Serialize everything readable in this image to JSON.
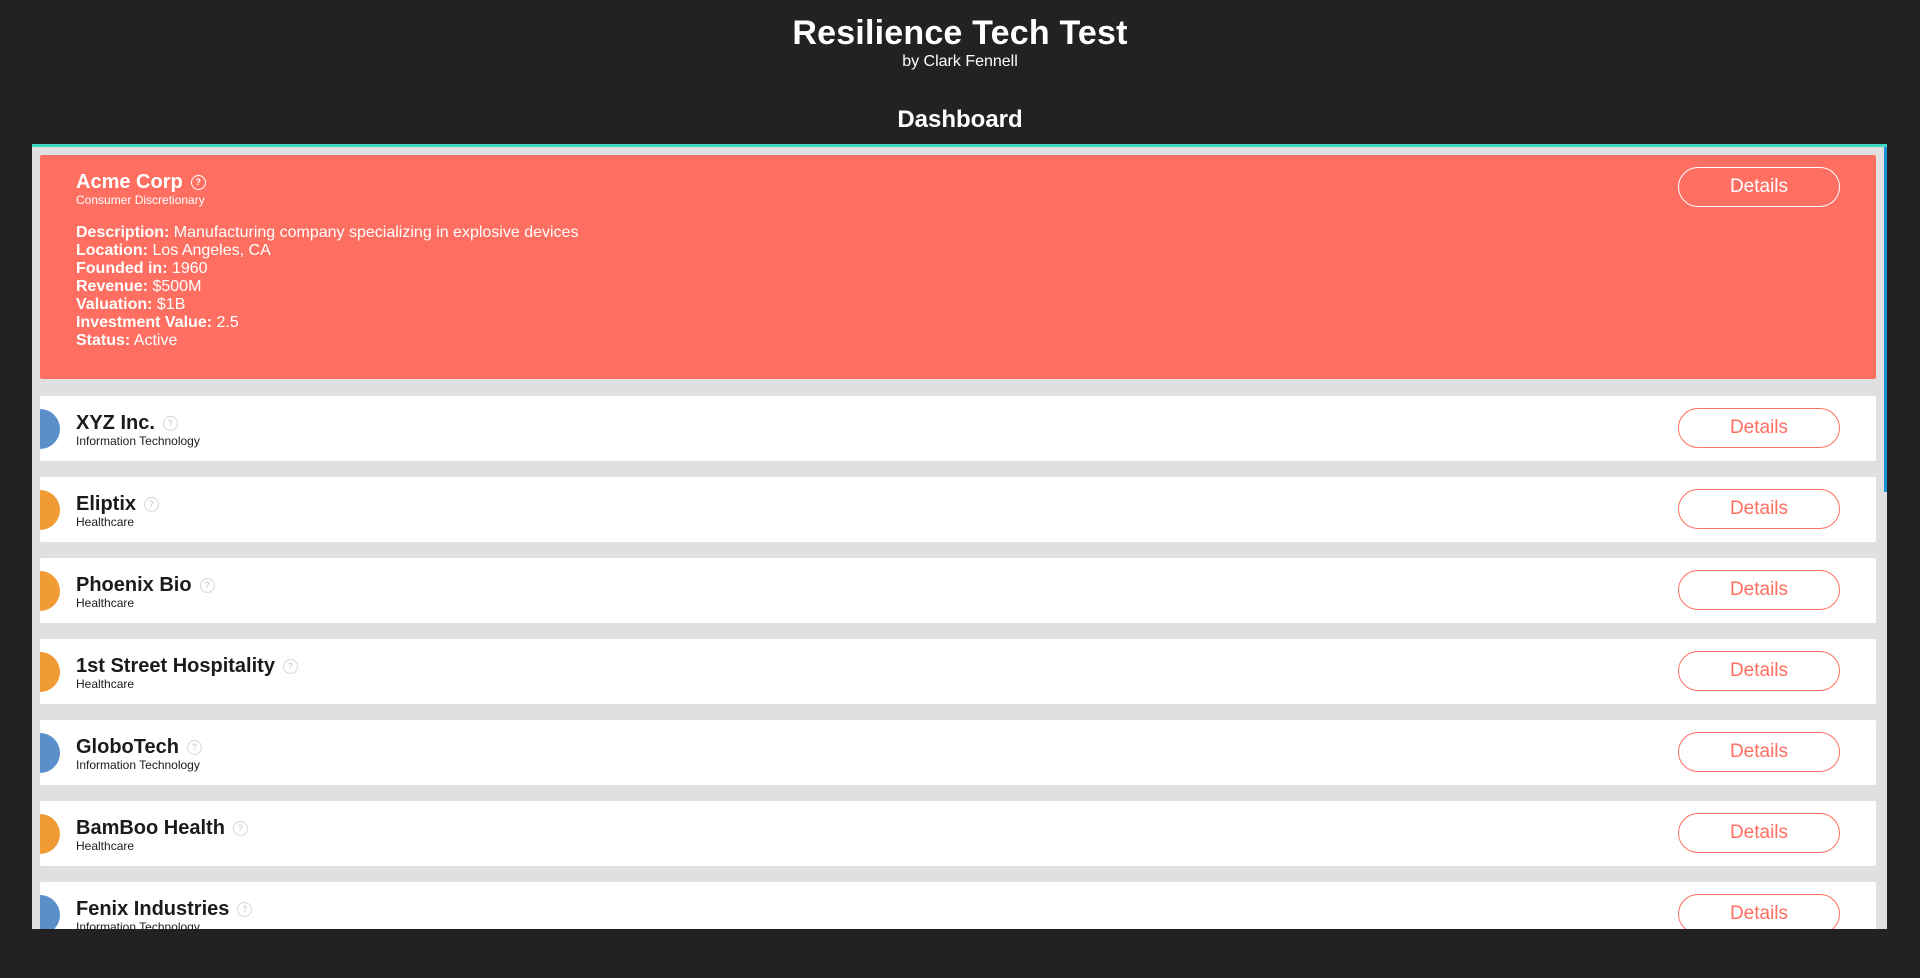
{
  "header": {
    "title": "Resilience Tech Test",
    "byline": "by Clark Fennell"
  },
  "section_title": "Dashboard",
  "colors": {
    "background": "#232223",
    "expanded_card": "#ff6f61",
    "panel_border": "#3fd8c6",
    "it_accent": "#5b8fc9",
    "healthcare_accent": "#f09b34"
  },
  "details_label": "Details",
  "help_icon": "question-circle-icon",
  "expanded_company": {
    "name": "Acme Corp",
    "sector": "Consumer Discretionary",
    "fields": [
      {
        "label": "Description:",
        "value": "Manufacturing company specializing in explosive devices"
      },
      {
        "label": "Location:",
        "value": "Los Angeles, CA"
      },
      {
        "label": "Founded in:",
        "value": "1960"
      },
      {
        "label": "Revenue:",
        "value": "$500M"
      },
      {
        "label": "Valuation:",
        "value": "$1B"
      },
      {
        "label": "Investment Value:",
        "value": "2.5"
      },
      {
        "label": "Status:",
        "value": "Active"
      }
    ]
  },
  "companies": [
    {
      "name": "XYZ Inc.",
      "sector": "Information Technology",
      "accent": "#5b8fc9"
    },
    {
      "name": "Eliptix",
      "sector": "Healthcare",
      "accent": "#f09b34"
    },
    {
      "name": "Phoenix Bio",
      "sector": "Healthcare",
      "accent": "#f09b34"
    },
    {
      "name": "1st Street Hospitality",
      "sector": "Healthcare",
      "accent": "#f09b34"
    },
    {
      "name": "GloboTech",
      "sector": "Information Technology",
      "accent": "#5b8fc9"
    },
    {
      "name": "BamBoo Health",
      "sector": "Healthcare",
      "accent": "#f09b34"
    },
    {
      "name": "Fenix Industries",
      "sector": "Information Technology",
      "accent": "#5b8fc9"
    }
  ]
}
